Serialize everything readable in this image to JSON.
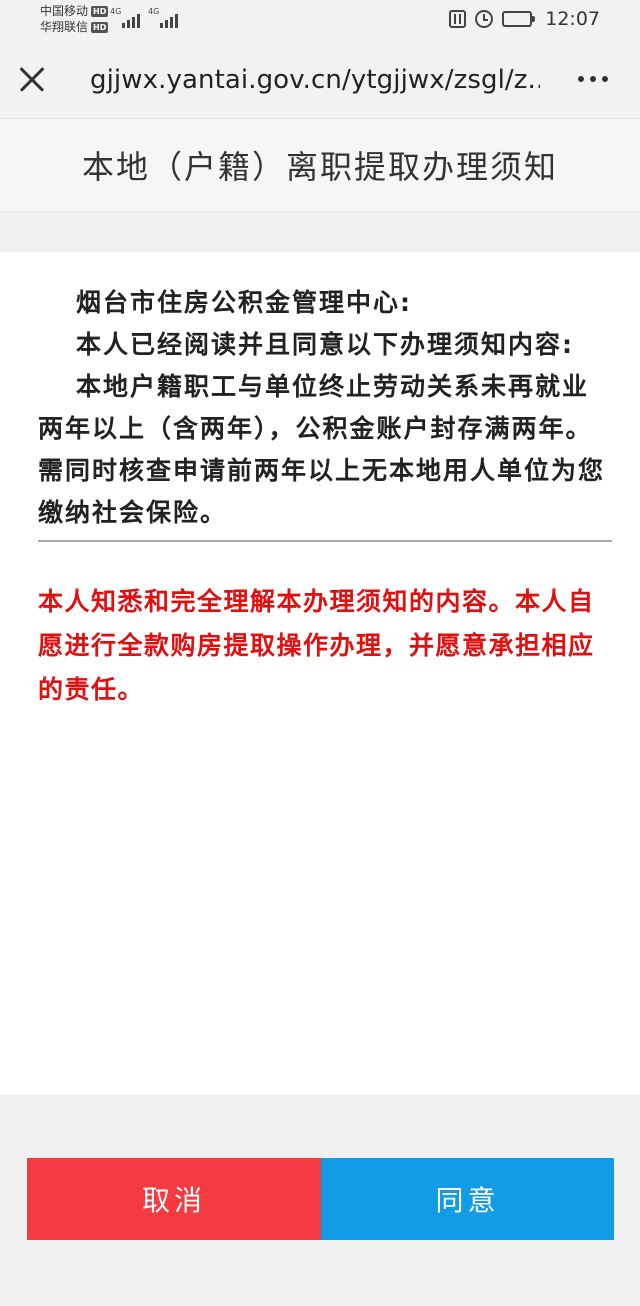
{
  "status_bar": {
    "carrier1": "中国移动",
    "carrier2": "华翔联信",
    "hd_badge": "HD",
    "network_type": "4G",
    "time": "12:07"
  },
  "browser": {
    "url": "gjjwx.yantai.gov.cn/ytgjjwx/zsgl/z...",
    "icons": {
      "close": "close-icon",
      "more": "more-icon"
    }
  },
  "page": {
    "title": "本地（户籍）离职提取办理须知"
  },
  "notice": {
    "recipient": "烟台市住房公积金管理中心:",
    "statement": "本人已经阅读并且同意以下办理须知内容:",
    "body": "本地户籍职工与单位终止劳动关系未再就业两年以上（含两年），公积金账户封存满两年。需同时核查申请前两年以上无本地用人单位为您缴纳社会保险。"
  },
  "agreement_text": "本人知悉和完全理解本办理须知的内容。本人自愿进行全款购房提取操作办理，并愿意承担相应的责任。",
  "buttons": {
    "cancel": "取消",
    "agree": "同意"
  },
  "colors": {
    "cancel_bg": "#f53b42",
    "agree_bg": "#119ce8",
    "agreement_text": "#e01010"
  }
}
